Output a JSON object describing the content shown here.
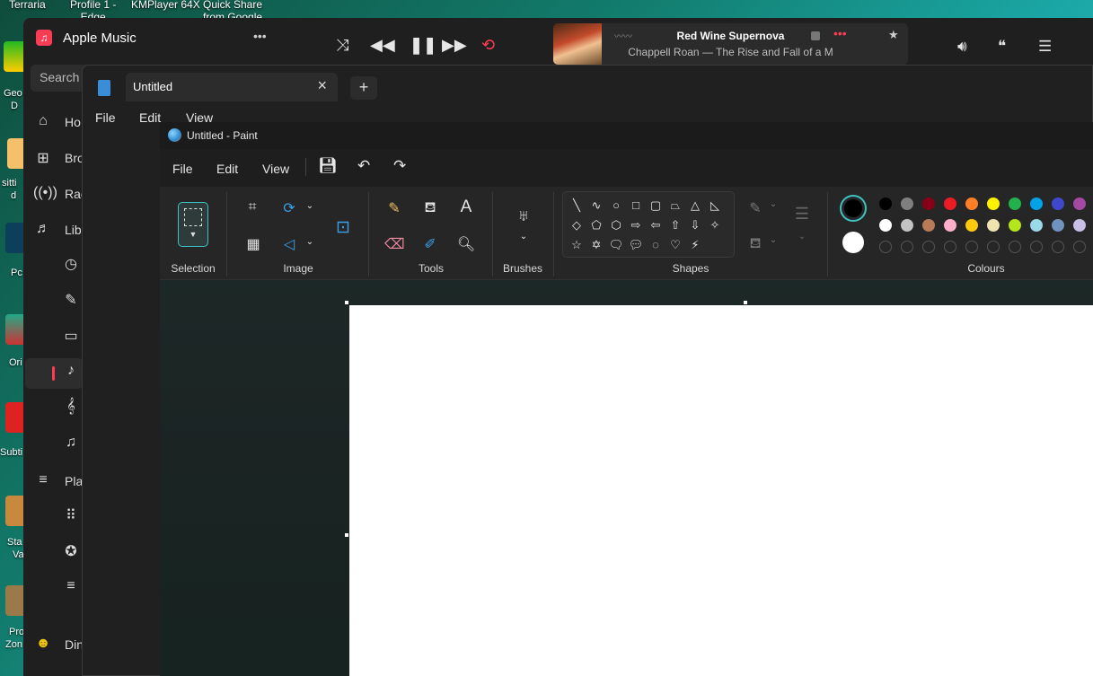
{
  "desktop": {
    "top_labels": [
      "Terraria",
      "Profile 1 -\nEdge",
      "KMPlayer 64X",
      "Quick Share\nfrom Google"
    ],
    "side_labels": [
      "Geo",
      "D",
      "sitti",
      "d",
      "Pc",
      "Ori",
      "Subti",
      "Sta",
      "Va",
      "Pro",
      "Zon"
    ]
  },
  "apple_music": {
    "title": "Apple Music",
    "menu_icon": "ellipsis-icon",
    "search_placeholder": "Search",
    "now_playing": {
      "title": "Red Wine Supernova",
      "subtitle": "Chappell Roan — The Rise and Fall of a M"
    },
    "nav": [
      "Ho",
      "Bro",
      "Rac",
      "Lib",
      "Pla",
      "Din"
    ],
    "accent": "#fa3c55"
  },
  "notepad": {
    "tab_title": "Untitled",
    "menu": [
      "File",
      "Edit",
      "View"
    ]
  },
  "paint": {
    "title": "Untitled - Paint",
    "menu": [
      "File",
      "Edit",
      "View"
    ],
    "groups": {
      "selection": "Selection",
      "image": "Image",
      "tools": "Tools",
      "brushes": "Brushes",
      "shapes": "Shapes",
      "colours": "Colours"
    },
    "palette_row1": [
      "#000000",
      "#7f7f7f",
      "#880015",
      "#ed1c24",
      "#ff7f27",
      "#fff200",
      "#22b14c",
      "#00a2e8",
      "#3f48cc",
      "#a349a4"
    ],
    "palette_row2": [
      "#ffffff",
      "#c3c3c3",
      "#b97a57",
      "#ffaec9",
      "#ffc90e",
      "#efe4b0",
      "#b5e61d",
      "#99d9ea",
      "#7092be",
      "#c8bfe7"
    ],
    "accent": "#3ec2c2"
  }
}
